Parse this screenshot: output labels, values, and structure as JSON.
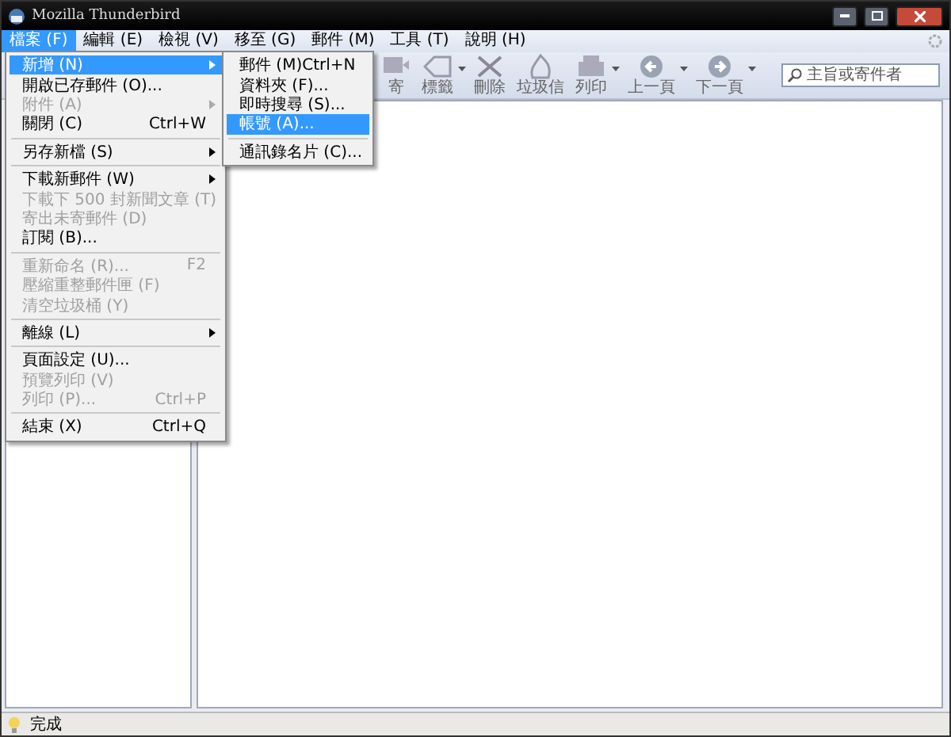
{
  "window": {
    "title": "Mozilla Thunderbird"
  },
  "menubar": [
    {
      "label": "檔案 (F)",
      "selected": true
    },
    {
      "label": "編輯 (E)",
      "selected": false
    },
    {
      "label": "檢視 (V)",
      "selected": false
    },
    {
      "label": "移至 (G)",
      "selected": false
    },
    {
      "label": "郵件 (M)",
      "selected": false
    },
    {
      "label": "工具 (T)",
      "selected": false
    },
    {
      "label": "說明 (H)",
      "selected": false
    }
  ],
  "toolbar": [
    {
      "label": "寄",
      "dropdown": false
    },
    {
      "label": "標籤",
      "dropdown": true
    },
    {
      "label": "刪除",
      "dropdown": false
    },
    {
      "label": "垃圾信",
      "dropdown": false
    },
    {
      "label": "列印",
      "dropdown": true
    },
    {
      "label": "上一頁",
      "dropdown": true
    },
    {
      "label": "下一頁",
      "dropdown": true
    }
  ],
  "search": {
    "placeholder": "主旨或寄件者"
  },
  "file_menu": [
    {
      "kind": "item",
      "label": "新增 (N)",
      "submenu": true,
      "disabled": false,
      "selected": true
    },
    {
      "kind": "item",
      "label": "開啟已存郵件 (O)...",
      "submenu": false,
      "disabled": false,
      "selected": false
    },
    {
      "kind": "item",
      "label": "附件 (A)",
      "submenu": true,
      "disabled": true,
      "selected": false
    },
    {
      "kind": "item",
      "label": "關閉 (C)",
      "shortcut": "Ctrl+W",
      "submenu": false,
      "disabled": false,
      "selected": false
    },
    {
      "kind": "separator"
    },
    {
      "kind": "item",
      "label": "另存新檔 (S)",
      "submenu": true,
      "disabled": false,
      "selected": false
    },
    {
      "kind": "separator"
    },
    {
      "kind": "item",
      "label": "下載新郵件 (W)",
      "submenu": true,
      "disabled": false,
      "selected": false
    },
    {
      "kind": "item",
      "label": "下載下 500 封新聞文章 (T)",
      "submenu": false,
      "disabled": true,
      "selected": false
    },
    {
      "kind": "item",
      "label": "寄出未寄郵件 (D)",
      "submenu": false,
      "disabled": true,
      "selected": false
    },
    {
      "kind": "item",
      "label": "訂閱 (B)...",
      "submenu": false,
      "disabled": false,
      "selected": false
    },
    {
      "kind": "separator"
    },
    {
      "kind": "item",
      "label": "重新命名 (R)...",
      "shortcut": "F2",
      "submenu": false,
      "disabled": true,
      "selected": false
    },
    {
      "kind": "item",
      "label": "壓縮重整郵件匣 (F)",
      "submenu": false,
      "disabled": true,
      "selected": false
    },
    {
      "kind": "item",
      "label": "清空垃圾桶 (Y)",
      "submenu": false,
      "disabled": true,
      "selected": false
    },
    {
      "kind": "separator"
    },
    {
      "kind": "item",
      "label": "離線 (L)",
      "submenu": true,
      "disabled": false,
      "selected": false
    },
    {
      "kind": "separator"
    },
    {
      "kind": "item",
      "label": "頁面設定 (U)...",
      "submenu": false,
      "disabled": false,
      "selected": false
    },
    {
      "kind": "item",
      "label": "預覽列印 (V)",
      "submenu": false,
      "disabled": true,
      "selected": false
    },
    {
      "kind": "item",
      "label": "列印 (P)...",
      "shortcut": "Ctrl+P",
      "submenu": false,
      "disabled": true,
      "selected": false
    },
    {
      "kind": "separator"
    },
    {
      "kind": "item",
      "label": "結束 (X)",
      "shortcut": "Ctrl+Q",
      "submenu": false,
      "disabled": false,
      "selected": false
    }
  ],
  "new_submenu": [
    {
      "kind": "item",
      "label": "郵件 (M)",
      "shortcut": "Ctrl+N",
      "submenu": false,
      "disabled": false,
      "selected": false
    },
    {
      "kind": "item",
      "label": "資料夾 (F)...",
      "submenu": false,
      "disabled": false,
      "selected": false
    },
    {
      "kind": "item",
      "label": "即時搜尋 (S)...",
      "submenu": false,
      "disabled": false,
      "selected": false
    },
    {
      "kind": "item",
      "label": "帳號 (A)...",
      "submenu": false,
      "disabled": false,
      "selected": true
    },
    {
      "kind": "separator"
    },
    {
      "kind": "item",
      "label": "通訊錄名片 (C)...",
      "submenu": false,
      "disabled": false,
      "selected": false
    }
  ],
  "status_bar": {
    "text": "完成"
  }
}
